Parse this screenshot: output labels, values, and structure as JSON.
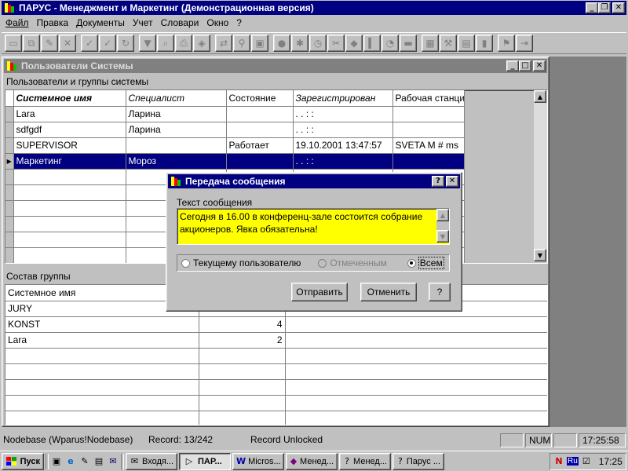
{
  "app": {
    "title": "ПАРУС - Менеджмент и Маркетинг (Демонстрационная версия)",
    "menu": [
      "Файл",
      "Правка",
      "Документы",
      "Учет",
      "Словари",
      "Окно",
      "?"
    ]
  },
  "child_window": {
    "title": "Пользователи Системы",
    "section1_label": "Пользователи и группы системы",
    "users_columns": [
      "Системное имя",
      "Специалист",
      "Состояние",
      "Зарегистрирован",
      "Рабочая станци"
    ],
    "users_rows": [
      [
        "Lara",
        "Ларина",
        "",
        ". .       :  :",
        ""
      ],
      [
        "sdfgdf",
        "Ларина",
        "",
        ". .       :  :",
        ""
      ],
      [
        "SUPERVISOR",
        "",
        "Работает",
        "19.10.2001 13:47:57",
        "SVETA M # ms"
      ],
      [
        "Маркетинг",
        "Мороз",
        "",
        ". .       :  :",
        ""
      ]
    ],
    "selected_row_index": 3,
    "section2_label": "Состав группы",
    "group_columns": [
      "Системное имя",
      "",
      ""
    ],
    "group_rows": [
      [
        "JURY",
        "",
        ""
      ],
      [
        "KONST",
        "4",
        ""
      ],
      [
        "Lara",
        "2",
        ""
      ]
    ]
  },
  "dialog": {
    "title": "Передача сообщения",
    "text_label": "Текст сообщения",
    "message": "Сегодня в 16.00 в конференц-зале состоится собрание акционеров. Явка обязательна!",
    "radio_current": "Текущему пользователю",
    "radio_marked": "Отмеченным",
    "radio_all": "Всем",
    "selected_radio": "all",
    "send_label": "Отправить",
    "cancel_label": "Отменить",
    "help_label": "?",
    "help_caption": "?",
    "close_caption": "✕"
  },
  "statusbar": {
    "database": "Nodebase (Wparus!Nodebase)",
    "record": "Record: 13/242",
    "lock": "Record Unlocked",
    "num": "NUM",
    "time": "17:25:58"
  },
  "taskbar": {
    "start_label": "Пуск",
    "buttons": [
      "Входя...",
      "ПАР...",
      "Micros...",
      "Менед...",
      "Менед...",
      "Парус ..."
    ],
    "active_index": 1,
    "tray_lang": "Ru",
    "tray_time": "17:25"
  },
  "colors": {
    "title_active": "#000080",
    "message_bg": "#ffff00",
    "desktop": "#c0c0c0"
  }
}
